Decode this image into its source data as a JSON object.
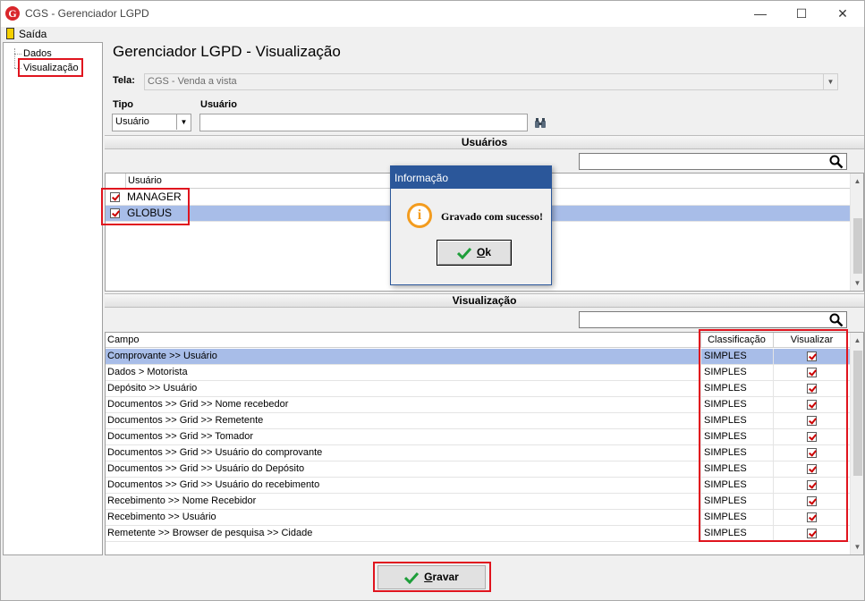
{
  "window": {
    "title": "CGS - Gerenciador LGPD",
    "logo": "G",
    "minimize": "—",
    "maximize": "☐",
    "close": "✕"
  },
  "menu": {
    "exit_label": "Saída"
  },
  "tree": {
    "items": [
      {
        "label": "Dados"
      },
      {
        "label": "Visualização"
      }
    ]
  },
  "page_title": "Gerenciador LGPD - Visualização",
  "form": {
    "tela_label": "Tela:",
    "tela_value": "CGS - Venda a vista",
    "tipo_label": "Tipo",
    "tipo_value": "Usuário",
    "usuario_label": "Usuário",
    "usuario_value": ""
  },
  "users_section": {
    "title": "Usuários",
    "column": "Usuário",
    "rows": [
      {
        "name": "MANAGER",
        "checked": true,
        "selected": false
      },
      {
        "name": "GLOBUS",
        "checked": true,
        "selected": true
      }
    ]
  },
  "visualization_section": {
    "title": "Visualização",
    "columns": {
      "campo": "Campo",
      "classificacao": "Classificação",
      "visualizar": "Visualizar"
    },
    "rows": [
      {
        "campo": "Comprovante >> Usuário",
        "classificacao": "SIMPLES",
        "visualizar": true,
        "selected": true
      },
      {
        "campo": "Dados > Motorista",
        "classificacao": "SIMPLES",
        "visualizar": true
      },
      {
        "campo": "Depósito >> Usuário",
        "classificacao": "SIMPLES",
        "visualizar": true
      },
      {
        "campo": "Documentos >> Grid >> Nome recebedor",
        "classificacao": "SIMPLES",
        "visualizar": true
      },
      {
        "campo": "Documentos >> Grid >> Remetente",
        "classificacao": "SIMPLES",
        "visualizar": true
      },
      {
        "campo": "Documentos >> Grid >> Tomador",
        "classificacao": "SIMPLES",
        "visualizar": true
      },
      {
        "campo": "Documentos >> Grid >> Usuário do comprovante",
        "classificacao": "SIMPLES",
        "visualizar": true
      },
      {
        "campo": "Documentos >> Grid >> Usuário do Depósito",
        "classificacao": "SIMPLES",
        "visualizar": true
      },
      {
        "campo": "Documentos >> Grid >> Usuário do recebimento",
        "classificacao": "SIMPLES",
        "visualizar": true
      },
      {
        "campo": "Recebimento >> Nome Recebidor",
        "classificacao": "SIMPLES",
        "visualizar": true
      },
      {
        "campo": "Recebimento >> Usuário",
        "classificacao": "SIMPLES",
        "visualizar": true
      },
      {
        "campo": "Remetente >> Browser de pesquisa >> Cidade",
        "classificacao": "SIMPLES",
        "visualizar": true
      }
    ]
  },
  "dialog": {
    "title": "Informação",
    "message": "Gravado com sucesso!",
    "icon": "i",
    "ok_accel": "O",
    "ok_rest": "k"
  },
  "footer": {
    "save_accel": "G",
    "save_rest": "ravar"
  },
  "colors": {
    "highlight": "#e0141e",
    "selection": "#a8bde8",
    "dialog_title": "#2b579a",
    "check": "#1e9e3a"
  }
}
